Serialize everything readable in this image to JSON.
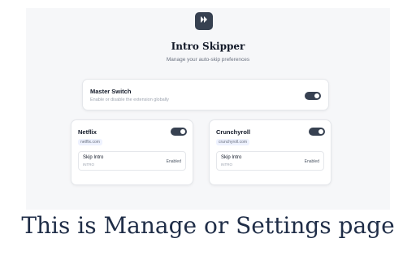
{
  "app": {
    "logo_icon": "fast-forward-icon",
    "title": "Intro Skipper",
    "subtitle": "Manage your auto-skip preferences"
  },
  "master": {
    "label": "Master Switch",
    "description": "Enable or disable the extension globally",
    "enabled": true
  },
  "services": [
    {
      "name": "Netflix",
      "domain": "netflix.com",
      "enabled": true,
      "skip": {
        "label": "Skip Intro",
        "code": "INTRO",
        "status": "Enabled"
      }
    },
    {
      "name": "Crunchyroll",
      "domain": "crunchyroll.com",
      "enabled": true,
      "skip": {
        "label": "Skip Intro",
        "code": "INTRO",
        "status": "Enabled"
      }
    }
  ],
  "caption": "This is Manage or Settings page",
  "colors": {
    "accent": "#374151",
    "background": "#f6f7f9",
    "caption_text": "#1f2d47"
  }
}
